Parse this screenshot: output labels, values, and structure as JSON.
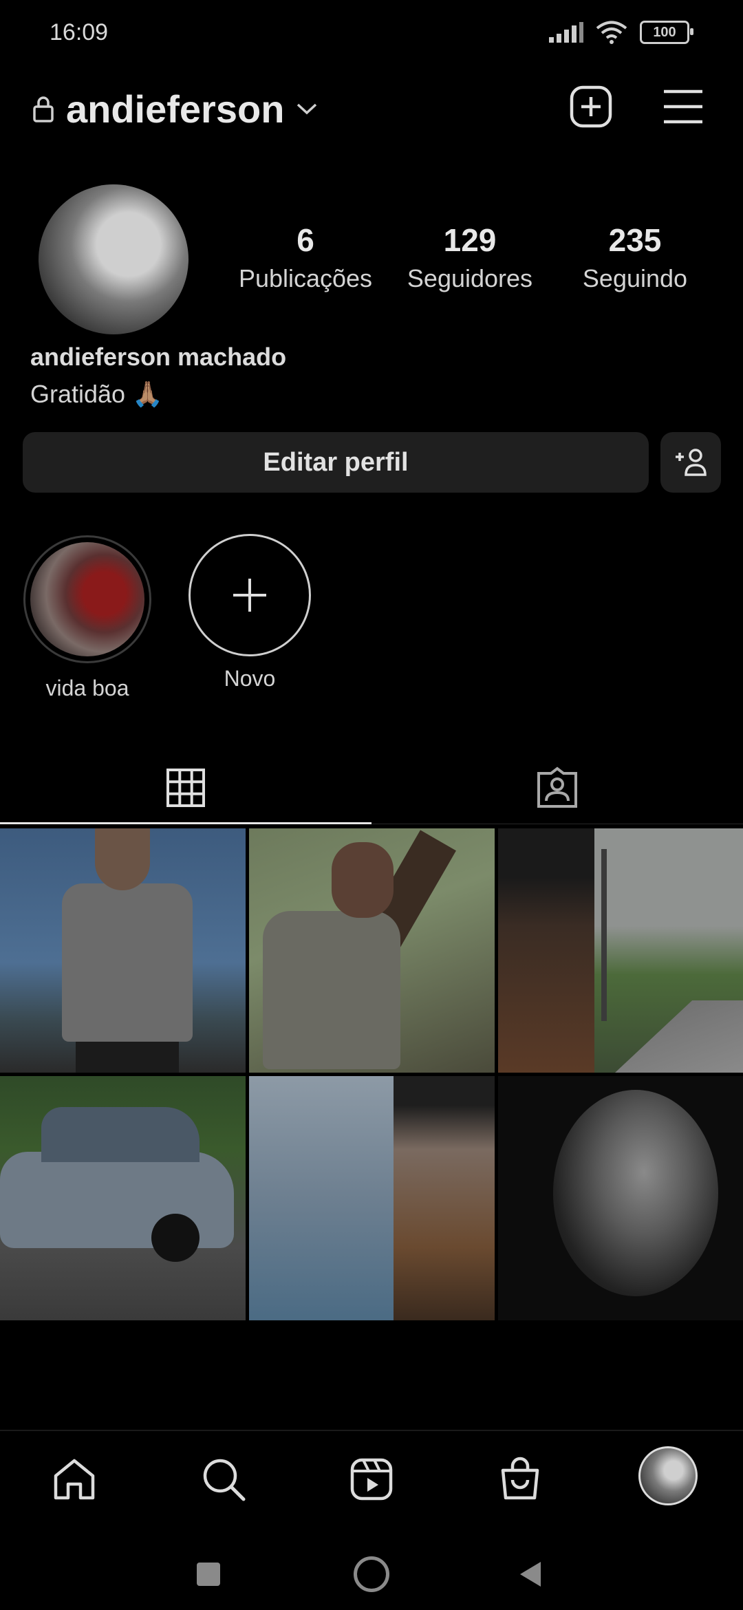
{
  "status": {
    "time": "16:09",
    "battery": "100"
  },
  "header": {
    "username": "andieferson"
  },
  "profile": {
    "stats": [
      {
        "count": "6",
        "label": "Publicações"
      },
      {
        "count": "129",
        "label": "Seguidores"
      },
      {
        "count": "235",
        "label": "Seguindo"
      }
    ],
    "full_name": "andieferson machado",
    "bio": "Gratidão 🙏🏽",
    "edit_label": "Editar perfil"
  },
  "highlights": [
    {
      "label": "vida boa"
    },
    {
      "label": "Novo"
    }
  ],
  "icons": {
    "lock": "lock-icon",
    "chevron": "chevron-down-icon",
    "new_post": "plus-square-icon",
    "menu": "hamburger-menu-icon",
    "add_person": "add-person-icon",
    "grid": "grid-icon",
    "tagged": "tagged-person-icon",
    "home": "home-icon",
    "search": "search-icon",
    "reels": "reels-icon",
    "shop": "shop-bag-icon"
  }
}
